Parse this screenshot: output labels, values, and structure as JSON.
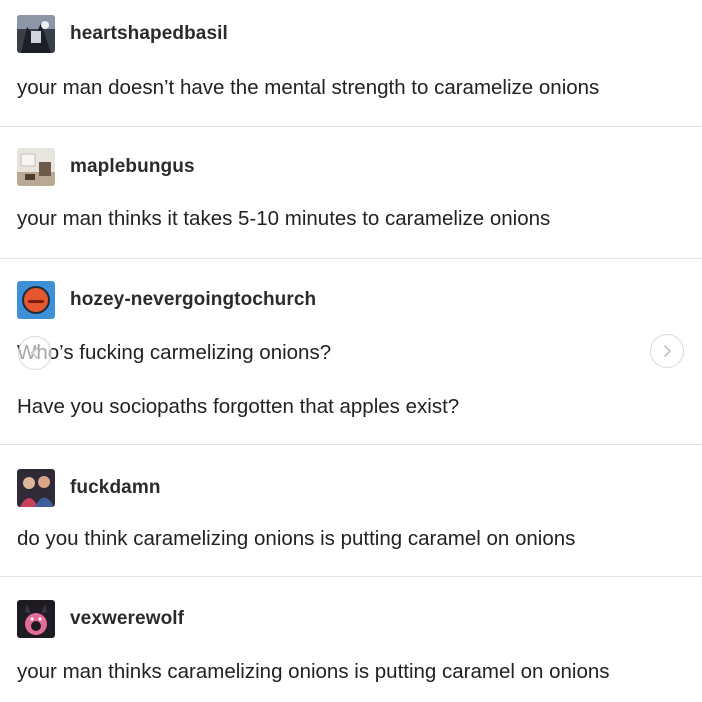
{
  "posts": [
    {
      "username": "heartshapedbasil",
      "avatar_icon": "dark-photo-avatar-icon",
      "lines": [
        "your man doesn’t have the mental strength to caramelize onions"
      ]
    },
    {
      "username": "maplebungus",
      "avatar_icon": "room-photo-avatar-icon",
      "lines": [
        "your man thinks it takes 5-10 minutes to caramelize onions"
      ]
    },
    {
      "username": "hozey-nevergoingtochurch",
      "avatar_icon": "orange-face-avatar-icon",
      "lines": [
        "Who’s fucking carmelizing onions?",
        "Have you sociopaths forgotten that apples exist?"
      ]
    },
    {
      "username": "fuckdamn",
      "avatar_icon": "two-people-avatar-icon",
      "lines": [
        "do you think caramelizing onions is putting caramel on onions"
      ]
    },
    {
      "username": "vexwerewolf",
      "avatar_icon": "pink-creature-avatar-icon",
      "lines": [
        "your man thinks caramelizing onions is putting caramel on onions"
      ]
    }
  ],
  "navigation": {
    "prev_icon": "chevron-left-icon",
    "next_icon": "chevron-right-icon"
  },
  "colors": {
    "background": "#ffffff",
    "divider": "#e3e3e3",
    "text": "#222222",
    "avatar_blue": "#3d8fd6",
    "avatar_orange": "#e4572e"
  }
}
